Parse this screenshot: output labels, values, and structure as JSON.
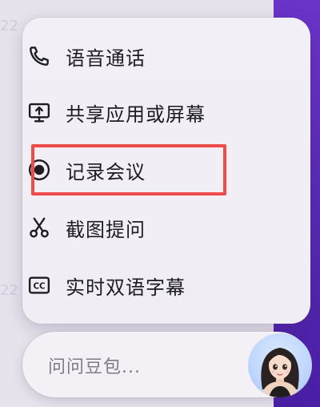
{
  "menu": {
    "items": [
      {
        "label": "语音通话",
        "icon": "phone-icon"
      },
      {
        "label": "共享应用或屏幕",
        "icon": "screen-share-icon"
      },
      {
        "label": "记录会议",
        "icon": "record-icon"
      },
      {
        "label": "截图提问",
        "icon": "scissors-icon"
      },
      {
        "label": "实时双语字幕",
        "icon": "cc-icon"
      }
    ]
  },
  "input": {
    "placeholder": "问问豆包..."
  },
  "avatar": {
    "icon": "assistant-avatar"
  },
  "colors": {
    "highlight": "#ee4b4b",
    "background_accent": "#5a2ab8"
  }
}
